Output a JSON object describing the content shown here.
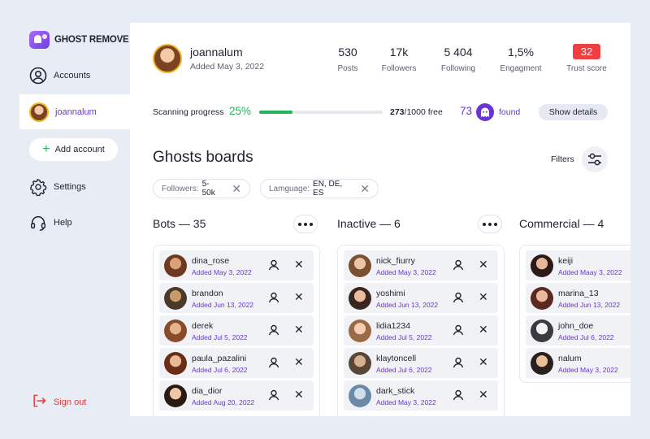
{
  "app": {
    "brand": "GHOST REMOVE"
  },
  "sidebar": {
    "accounts_label": "Accounts",
    "active_account": "joannalum",
    "add_account_label": "Add account",
    "settings_label": "Settings",
    "help_label": "Help",
    "signout_label": "Sign out"
  },
  "profile": {
    "name": "joannalum",
    "added": "Added May 3, 2022",
    "stats": {
      "posts_value": "530",
      "posts_label": "Posts",
      "followers_value": "17k",
      "followers_label": "Followers",
      "following_value": "5 404",
      "following_label": "Following",
      "engagement_value": "1,5%",
      "engagement_label": "Engagment",
      "trust_value": "32",
      "trust_label": "Trust score"
    }
  },
  "scan": {
    "label": "Scanning progress",
    "percent_text": "25%",
    "progress": 0.27,
    "done": "273",
    "total": "/1000 free",
    "found_count": "73",
    "found_label": "found",
    "details_label": "Show details"
  },
  "boards": {
    "title": "Ghosts boards",
    "filters_label": "Filters",
    "chips": [
      {
        "key": "Followers:",
        "value": "5-50k"
      },
      {
        "key": "Lamguage:",
        "value": "EN, DE, ES"
      }
    ],
    "columns": [
      {
        "title": "Bots — 35",
        "items": [
          {
            "name": "dina_rose",
            "added": "Added May 3, 2022"
          },
          {
            "name": "brandon",
            "added": "Added Jun 13, 2022"
          },
          {
            "name": "derek",
            "added": "Added Jul 5, 2022"
          },
          {
            "name": "paula_pazalini",
            "added": "Added Jul 6, 2022"
          },
          {
            "name": "dia_dior",
            "added": "Added Aug 20, 2022"
          }
        ]
      },
      {
        "title": "Inactive — 6",
        "items": [
          {
            "name": "nick_fiurry",
            "added": "Added May 3, 2022"
          },
          {
            "name": "yoshimi",
            "added": "Added Jun 13, 2022"
          },
          {
            "name": "lidia1234",
            "added": "Added Jul 5, 2022"
          },
          {
            "name": "klaytoncell",
            "added": "Added Jul 6, 2022"
          },
          {
            "name": "dark_stick",
            "added": "Added May 3, 2022"
          }
        ]
      },
      {
        "title": "Commercial — 4",
        "items": [
          {
            "name": "keiji",
            "added": "Added Maay 3, 2022"
          },
          {
            "name": "marina_13",
            "added": "Added Jun 13, 2022"
          },
          {
            "name": "john_doe",
            "added": "Added Jul 6, 2022"
          },
          {
            "name": "nalum",
            "added": "Added May 3, 2022"
          }
        ]
      }
    ]
  },
  "colors": {
    "accent": "#6a35d8",
    "success": "#22b55a",
    "danger": "#ee4040"
  }
}
